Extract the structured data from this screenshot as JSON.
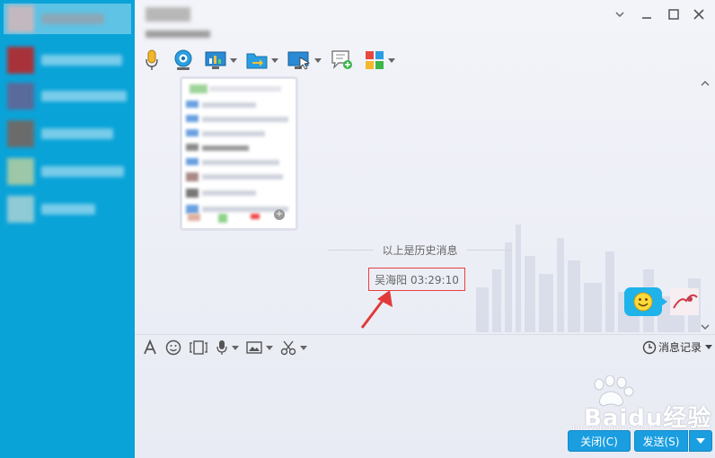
{
  "history_divider_text": "以上是历史消息",
  "sender_line": "吴海阳 03:29:10",
  "history_button_label": "消息记录",
  "close_button_label": "关闭(C)",
  "send_button_label": "发送(S)",
  "watermark": {
    "text": "Baidu经验",
    "url": "jingyan.baidu.com"
  },
  "colors": {
    "sidebar": "#0aa3d8",
    "button": "#1a9ee0",
    "highlight_box": "#e64040"
  },
  "toolbar_icons": [
    "microphone-icon",
    "video-camera-icon",
    "screen-share-icon",
    "file-transfer-icon",
    "remote-desktop-icon",
    "add-message-icon",
    "apps-grid-icon"
  ],
  "input_toolbar_icons": [
    "font-icon",
    "emoji-icon",
    "screenshot-frame-icon",
    "voice-message-icon",
    "image-icon",
    "scissors-icon"
  ]
}
